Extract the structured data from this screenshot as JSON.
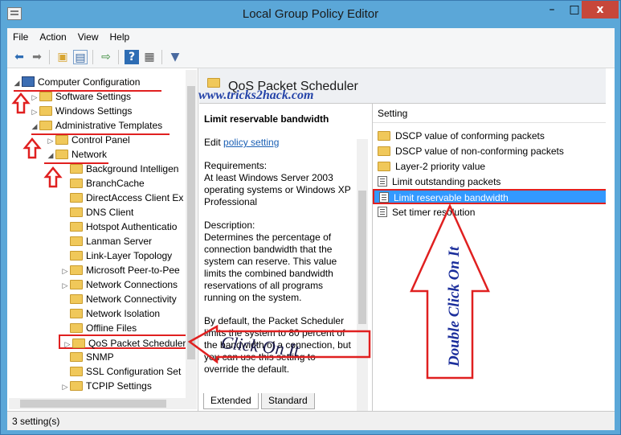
{
  "window": {
    "title": "Local Group Policy Editor",
    "minimize": "–",
    "maximize": "□",
    "close": "x"
  },
  "menu": [
    "File",
    "Action",
    "View",
    "Help"
  ],
  "toolbar_icons": [
    "back-icon",
    "forward-icon",
    "up-folder-icon",
    "show-hide-tree-icon",
    "export-list-icon",
    "help-icon",
    "properties-icon",
    "filter-icon"
  ],
  "tree": {
    "root": "Computer Configuration",
    "software_settings": "Software Settings",
    "windows_settings": "Windows Settings",
    "admin_templates": "Administrative Templates",
    "control_panel": "Control Panel",
    "network": "Network",
    "children": [
      "Background Intelligen",
      "BranchCache",
      "DirectAccess Client Ex",
      "DNS Client",
      "Hotspot Authenticatio",
      "Lanman Server",
      "Link-Layer Topology",
      "Microsoft Peer-to-Pee",
      "Network Connections",
      "Network Connectivity",
      "Network Isolation",
      "Offline Files",
      "QoS Packet Scheduler",
      "SNMP",
      "SSL Configuration Set",
      "TCPIP Settings"
    ]
  },
  "details": {
    "header": "QoS Packet Scheduler",
    "watermark": "www.tricks2hack.com",
    "setting_title": "Limit reservable bandwidth",
    "edit_prefix": "Edit",
    "edit_link": "policy setting",
    "requirements_label": "Requirements:",
    "requirements": "At least Windows Server 2003 operating systems or Windows XP Professional",
    "description_label": "Description:",
    "description": "Determines the percentage of connection bandwidth that the system can reserve. This value limits the combined bandwidth reservations of all programs running on the system.",
    "description2": "By default, the Packet Scheduler limits the system to 80 percent of the bandwidth of a connection, but you can use this setting to override the default."
  },
  "settings": {
    "column": "Setting",
    "items": [
      {
        "label": "DSCP value of conforming packets",
        "icon": "folder-icon"
      },
      {
        "label": "DSCP value of non-conforming packets",
        "icon": "folder-icon"
      },
      {
        "label": "Layer-2 priority value",
        "icon": "folder-icon"
      },
      {
        "label": "Limit outstanding packets",
        "icon": "setting-icon"
      },
      {
        "label": "Limit reservable bandwidth",
        "icon": "setting-icon"
      },
      {
        "label": "Set timer resolution",
        "icon": "setting-icon"
      }
    ]
  },
  "tabs": [
    "Extended",
    "Standard"
  ],
  "status": "3 setting(s)",
  "annotations": {
    "click": "Click On It",
    "double_click": "Double Click On It"
  },
  "colors": {
    "titlebar": "#5ba7d8",
    "selection": "#3399ff",
    "annotation_red": "#e02020",
    "close_button": "#c7473a"
  }
}
